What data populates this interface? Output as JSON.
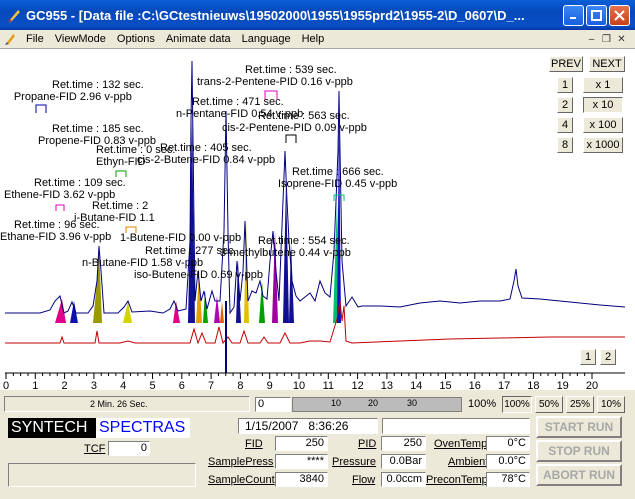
{
  "window": {
    "title": "GC955 - [Data file :C:\\GCtestnieuws\\19502000\\1955\\1955prd2\\1955-2\\D_0607\\D_..."
  },
  "menu": [
    "File",
    "ViewMode",
    "Options",
    "Animate data",
    "Language",
    "Help"
  ],
  "nav": {
    "prev": "PREV",
    "next": "NEXT"
  },
  "zoom": [
    {
      "num": "1",
      "label": "x 1"
    },
    {
      "num": "2",
      "label": "x 10"
    },
    {
      "num": "4",
      "label": "x 100"
    },
    {
      "num": "8",
      "label": "x 1000"
    }
  ],
  "pages": [
    "1",
    "2"
  ],
  "xaxis": {
    "ticks": [
      "0",
      "1",
      "2",
      "3",
      "4",
      "5",
      "6",
      "7",
      "8",
      "9",
      "10",
      "11",
      "12",
      "13",
      "14",
      "15",
      "16",
      "17",
      "18",
      "19",
      "20"
    ]
  },
  "annotations": [
    {
      "id": "a1",
      "text": [
        "Ret.time : 132 sec.",
        "Propane-FID 2.96 v-ppb"
      ]
    },
    {
      "id": "a2",
      "text": [
        "Ret.time : 185 sec.",
        "Propene-FID 0.83 v-ppb"
      ]
    },
    {
      "id": "a3",
      "text": [
        "Ret.time : 0 sec.",
        "Ethyn-FID"
      ]
    },
    {
      "id": "a4",
      "text": [
        "Ret.time : 109 sec.",
        "Ethene-FID 3.62 v-ppb"
      ]
    },
    {
      "id": "a5",
      "text": [
        "Ret.time : 96 sec.",
        "Ethane-FID 3.96 v-ppb"
      ]
    },
    {
      "id": "a6",
      "text": [
        "Ret.time : 405 sec.",
        "cis-2-Butene-FID 0.84 v-ppb"
      ]
    },
    {
      "id": "a7",
      "text": [
        "Ret.time : 539 sec.",
        "trans-2-Pentene-PID 0.16 v-ppb"
      ]
    },
    {
      "id": "a8",
      "text": [
        "Ret.time : 471 sec.",
        "n-Pentane-FID 0.54 v-ppb"
      ]
    },
    {
      "id": "a9",
      "text": [
        "Ret.time : 563 sec.",
        "cis-2-Pentene-PID 0.09 v-ppb"
      ]
    },
    {
      "id": "a10",
      "text": [
        "Ret.time : 666 sec.",
        "Isoprene-FID 0.45 v-ppb"
      ]
    },
    {
      "id": "a11",
      "text": [
        "Ret.time : 2",
        "i-Butane-FID 1.1"
      ]
    },
    {
      "id": "a12",
      "text": [
        "Ret.time : 277 sec.",
        "n-Butane-FID 1.58 v-ppb"
      ]
    },
    {
      "id": "a13",
      "text": [
        "iso-Butene-FID 0.69 v-ppb"
      ]
    },
    {
      "id": "a14",
      "text": [
        "Ret.time : 554 sec.",
        "3-methylbutene 0.44 v-ppb"
      ]
    },
    {
      "id": "a15",
      "text": [
        "Ret.time : 0 sec.",
        "1-Butene-FID 0.00 v-ppb"
      ]
    }
  ],
  "status": {
    "elapsed": "2 Min. 26 Sec.",
    "progress_value": "0",
    "progress_ticks": [
      "10",
      "20",
      "30"
    ],
    "zoom_pct": [
      "100%",
      "100%",
      "50%",
      "25%",
      "10%"
    ],
    "brand1": "SYNTECH",
    "brand2": "SPECTRAS",
    "tcf_label": "TCF",
    "tcf_value": "0",
    "date": "1/15/2007",
    "time": "8:36:26",
    "fid_label": "FID",
    "fid_value": "250",
    "pid_label": "PID",
    "pid_value": "250",
    "oventemp_label": "OvenTemp",
    "oventemp_value": "0°C",
    "samplepress_label": "SamplePress",
    "samplepress_value": "****",
    "pressure_label": "Pressure",
    "pressure_value": "0.0Bar",
    "ambient_label": "Ambient",
    "ambient_value": "0.0°C",
    "samplecount_label": "SampleCount",
    "samplecount_value": "3840",
    "flow_label": "Flow",
    "flow_value": "0.0ccm",
    "precontemp_label": "PreconTemp",
    "precontemp_value": "78°C",
    "start": "START RUN",
    "stop": "STOP RUN",
    "abort": "ABORT RUN"
  },
  "colors": {
    "titlebar": "#0a5fd8",
    "fid_trace": "#000080",
    "pid_trace": "#c00000",
    "brand1_bg": "#000000",
    "brand2_color": "#0000ff"
  }
}
